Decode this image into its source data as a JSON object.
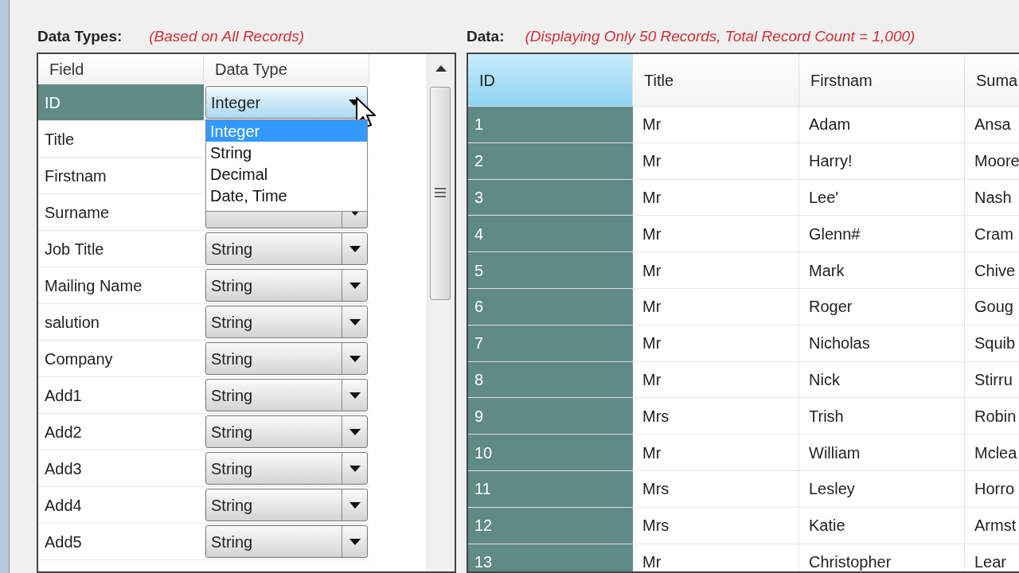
{
  "data_types_panel": {
    "label": "Data Types:",
    "note": "(Based on All Records)",
    "columns": [
      "Field",
      "Data Type"
    ],
    "rows": [
      {
        "field": "ID",
        "kind": "dropdown",
        "type": "Integer",
        "selected": true,
        "expanded": true
      },
      {
        "field": "Title",
        "kind": "plain",
        "selected": false,
        "expanded": false
      },
      {
        "field": "Firstnam",
        "kind": "plain",
        "selected": false,
        "expanded": false
      },
      {
        "field": "Surname",
        "kind": "dropdown",
        "selected": false,
        "expanded": false
      },
      {
        "field": "Job Title",
        "kind": "dropdown",
        "type": "String",
        "selected": false,
        "expanded": false
      },
      {
        "field": "Mailing Name",
        "kind": "dropdown",
        "type": "String",
        "selected": false,
        "expanded": false
      },
      {
        "field": "salution",
        "kind": "dropdown",
        "type": "String",
        "selected": false,
        "expanded": false
      },
      {
        "field": "Company",
        "kind": "dropdown",
        "type": "String",
        "selected": false,
        "expanded": false
      },
      {
        "field": "Add1",
        "kind": "dropdown",
        "type": "String",
        "selected": false,
        "expanded": false
      },
      {
        "field": "Add2",
        "kind": "dropdown",
        "type": "String",
        "selected": false,
        "expanded": false
      },
      {
        "field": "Add3",
        "kind": "dropdown",
        "type": "String",
        "selected": false,
        "expanded": false
      },
      {
        "field": "Add4",
        "kind": "dropdown",
        "type": "String",
        "selected": false,
        "expanded": false
      },
      {
        "field": "Add5",
        "kind": "dropdown",
        "type": "String",
        "selected": false,
        "expanded": false
      }
    ],
    "dropdown_options": [
      {
        "label": "Integer",
        "selected": true
      },
      {
        "label": "String",
        "selected": false
      },
      {
        "label": "Decimal",
        "selected": false
      },
      {
        "label": "Date, Time",
        "selected": false
      }
    ]
  },
  "data_panel": {
    "label": "Data:",
    "note": "(Displaying Only 50 Records, Total Record Count = 1,000)",
    "columns": [
      {
        "label": "ID",
        "selected": true
      },
      {
        "label": "Title",
        "selected": false
      },
      {
        "label": "Firstnam",
        "selected": false
      },
      {
        "label": "Suma",
        "selected": false
      }
    ],
    "rows": [
      [
        "1",
        "Mr",
        "Adam",
        "Ansa"
      ],
      [
        "2",
        "Mr",
        "Harry!",
        "Moore"
      ],
      [
        "3",
        "Mr",
        "Lee'",
        "Nash"
      ],
      [
        "4",
        "Mr",
        "Glenn#",
        "Cram"
      ],
      [
        "5",
        "Mr",
        "Mark",
        "Chive"
      ],
      [
        "6",
        "Mr",
        "Roger",
        "Goug"
      ],
      [
        "7",
        "Mr",
        "Nicholas",
        "Squib"
      ],
      [
        "8",
        "Mr",
        "Nick",
        "Stirru"
      ],
      [
        "9",
        "Mrs",
        "Trish",
        "Robin"
      ],
      [
        "10",
        "Mr",
        "William",
        "Mclea"
      ],
      [
        "11",
        "Mrs",
        "Lesley",
        "Horro"
      ],
      [
        "12",
        "Mrs",
        "Katie",
        "Armst"
      ],
      [
        "13",
        "Mr",
        "Christopher",
        "Lear"
      ]
    ]
  }
}
